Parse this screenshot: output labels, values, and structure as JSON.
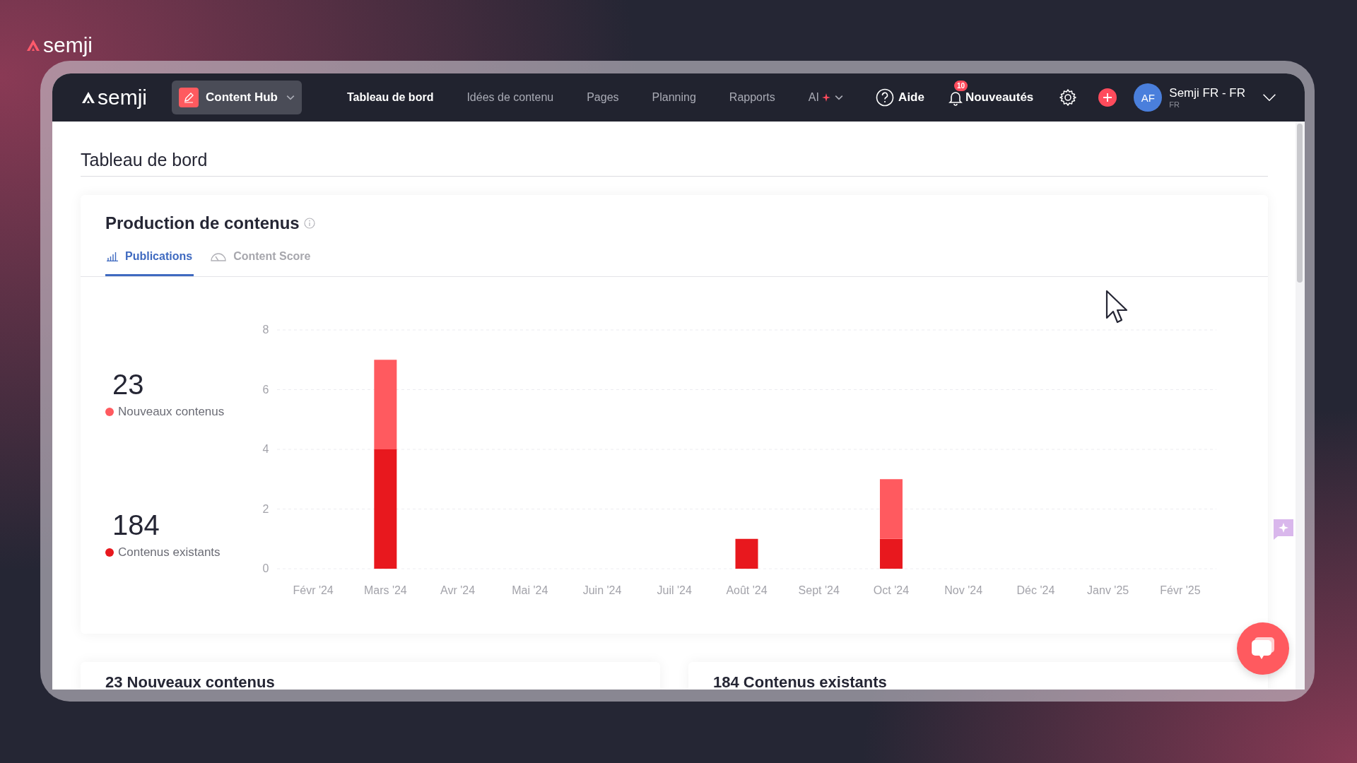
{
  "brand": {
    "name": "semji"
  },
  "nav": {
    "logo": "semji",
    "workspace": "Content Hub",
    "links": [
      {
        "label": "Tableau de bord",
        "selected": true
      },
      {
        "label": "Idées de contenu",
        "selected": false
      },
      {
        "label": "Pages",
        "selected": false
      },
      {
        "label": "Planning",
        "selected": false
      },
      {
        "label": "Rapports",
        "selected": false
      }
    ],
    "ai": {
      "label": "AI"
    },
    "help": "Aide",
    "news": {
      "label": "Nouveautés",
      "badge": "10"
    },
    "account": {
      "initials": "AF",
      "name": "Semji FR - FR",
      "sub": "FR"
    }
  },
  "page": {
    "title": "Tableau de bord"
  },
  "card": {
    "title": "Production de contenus",
    "tabs": [
      {
        "label": "Publications",
        "kind": "bars",
        "selected": true
      },
      {
        "label": "Content Score",
        "kind": "gauge",
        "selected": false
      }
    ],
    "stats": [
      {
        "value": "23"
      },
      {
        "value": "184"
      }
    ],
    "chart_data": {
      "type": "bar",
      "stacked": true,
      "grid": true,
      "categories": [
        "Févr '24",
        "Mars '24",
        "Avr '24",
        "Mai '24",
        "Juin '24",
        "Juil '24",
        "Août '24",
        "Sept '24",
        "Oct '24",
        "Nov '24",
        "Déc '24",
        "Janv '25",
        "Févr '25"
      ],
      "series": [
        {
          "name": "Nouveaux contenus",
          "color": "#ff5a5f",
          "values": [
            0,
            3,
            0,
            0,
            0,
            0,
            0,
            0,
            2,
            0,
            0,
            0,
            0
          ]
        },
        {
          "name": "Contenus existants",
          "color": "#e8181e",
          "values": [
            0,
            4,
            0,
            0,
            0,
            0,
            1,
            0,
            1,
            0,
            0,
            0,
            0
          ]
        }
      ],
      "ylim": [
        0,
        8
      ],
      "yticks": [
        0,
        2,
        4,
        6,
        8
      ]
    }
  },
  "sections": [
    {
      "title": "23 Nouveaux contenus"
    },
    {
      "title": "184 Contenus existants"
    }
  ]
}
